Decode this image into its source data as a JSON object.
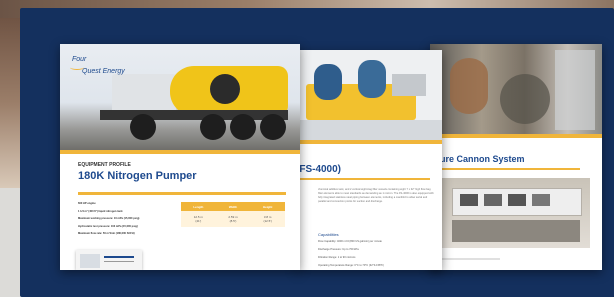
{
  "page1": {
    "logo_line1": "Four",
    "logo_line2": "Quest Energy",
    "eyebrow": "EQUIPMENT PROFILE",
    "title": "180K Nitrogen Pumper",
    "specs": [
      "600 HP engine",
      "1 1/4 m³ (400 ft³) liquid nitrogen tank",
      "Maximum working pressure: 10 mPa (15,000 psig)",
      "Hydrostatic test pressure: 103 mPa (15,000 psig)",
      "Maximum flow rate: 50 m³/min (180,000 SCFH)"
    ],
    "dims_headers": [
      "Length",
      "Width",
      "Height"
    ],
    "dims_values": [
      "12.5 m\n(41')",
      "2.59 m\n(8.5')",
      "3.8 m\n(12.5')"
    ]
  },
  "page2": {
    "title": "(FS-4000)",
    "body": "chemical additive tank, and 2 vertical eight-bag filter vessels containing eight 7 x 32\" high flow bag filter elements able to meet standards as demanding as 1 micron. The FS-4000 is also equipped with fully integrated stainless steel piping between elements, including a manifold to allow serial and parallel and connection points for suction and discharge.",
    "cap_heading": "Capabilities",
    "caps": [
      "Flow Capability: 4000 m³/d (800 US gal/min) per minute",
      "Discharge Pressure: Up to 700 kPa",
      "Filtration Range: 1 to 90 microns",
      "Operating Temperature Range: 0°C to 70°C (32°F-158°F)"
    ]
  },
  "page3": {
    "title": "ssure Cannon System"
  }
}
